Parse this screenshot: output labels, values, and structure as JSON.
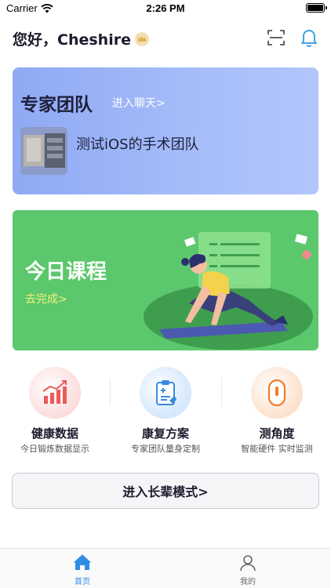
{
  "status_bar": {
    "carrier": "Carrier",
    "time": "2:26 PM"
  },
  "header": {
    "greeting": "您好，Cheshire"
  },
  "expert_card": {
    "title": "专家团队",
    "link": "进入聊天>",
    "team_name": "测试iOS的手术团队"
  },
  "course_card": {
    "title": "今日课程",
    "link": "去完成>"
  },
  "features": [
    {
      "title": "健康数据",
      "subtitle": "今日锻炼数据显示",
      "icon": "chart-icon"
    },
    {
      "title": "康复方案",
      "subtitle": "专家团队量身定制",
      "icon": "clipboard-icon"
    },
    {
      "title": "测角度",
      "subtitle": "智能硬件 实时监测",
      "icon": "device-icon"
    }
  ],
  "elder_mode": {
    "label": "进入长辈模式>"
  },
  "tab_bar": {
    "tabs": [
      {
        "label": "首页",
        "icon": "home-icon",
        "active": true
      },
      {
        "label": "我的",
        "icon": "person-icon",
        "active": false
      }
    ],
    "active_color": "#2f8de4"
  }
}
